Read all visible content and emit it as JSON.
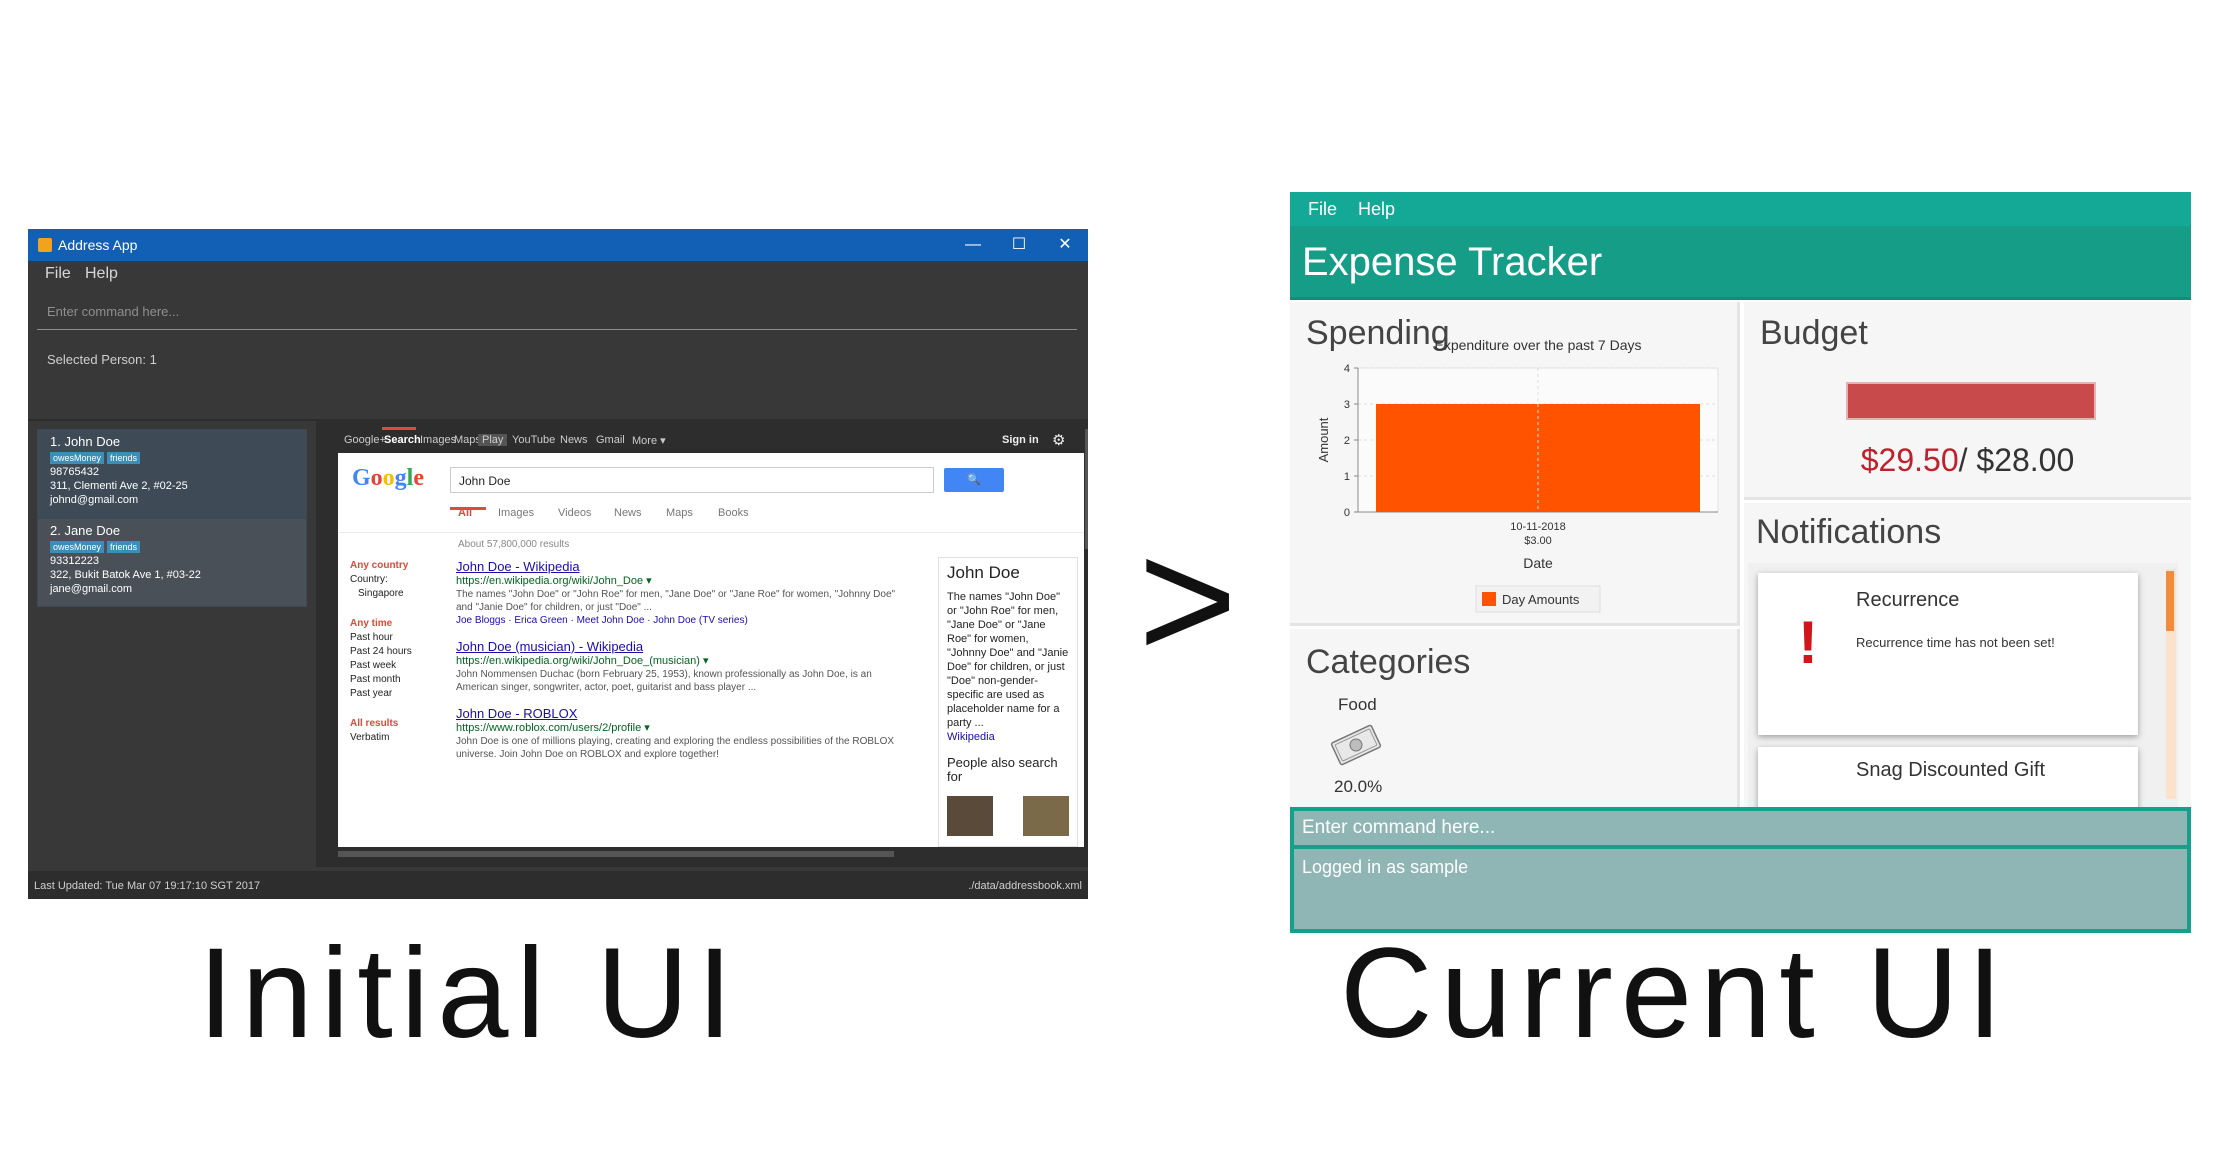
{
  "captions": {
    "initial": "Initial UI",
    "current": "Current UI",
    "arrow": ">"
  },
  "address_app": {
    "title": "Address App",
    "window_controls": {
      "minimize": "—",
      "maximize": "☐",
      "close": "✕"
    },
    "menu": [
      "File",
      "Help"
    ],
    "command_placeholder": "Enter command here...",
    "result": "Selected Person: 1",
    "persons": [
      {
        "name": "1. John Doe",
        "tags": [
          "owesMoney",
          "friends"
        ],
        "phone": "98765432",
        "address": "311, Clementi Ave 2, #02-25",
        "email": "johnd@gmail.com"
      },
      {
        "name": "2. Jane Doe",
        "tags": [
          "owesMoney",
          "friends"
        ],
        "phone": "93312223",
        "address": "322, Bukit Batok Ave 1, #03-22",
        "email": "jane@gmail.com"
      }
    ],
    "status_left": "Last Updated: Tue Mar 07 19:17:10 SGT 2017",
    "status_right": "./data/addressbook.xml",
    "colors": {
      "titlebar": "#1160b5",
      "panel": "#383838",
      "selected_card": "#3f4a57",
      "card": "#4a5058",
      "tag": "#3b8eb8"
    }
  },
  "browser": {
    "topbar": [
      "Google+",
      "Search",
      "Images",
      "Maps",
      "Play",
      "YouTube",
      "News",
      "Gmail",
      "More ▾"
    ],
    "sign_in": "Sign in",
    "logo_letters": [
      {
        "ch": "G",
        "color": "#4285f4"
      },
      {
        "ch": "o",
        "color": "#ea4335"
      },
      {
        "ch": "o",
        "color": "#fbbc05"
      },
      {
        "ch": "g",
        "color": "#4285f4"
      },
      {
        "ch": "l",
        "color": "#34a853"
      },
      {
        "ch": "e",
        "color": "#ea4335"
      }
    ],
    "query": "John Doe",
    "tabs": [
      "All",
      "Images",
      "Videos",
      "News",
      "Maps",
      "Books"
    ],
    "result_count": "About 57,800,000 results",
    "filters": {
      "country_heading": "Any country",
      "country_lines": [
        "Country:",
        "Singapore"
      ],
      "time_heading": "Any time",
      "time_lines": [
        "Past hour",
        "Past 24 hours",
        "Past week",
        "Past month",
        "Past year"
      ],
      "results_heading": "All results",
      "results_lines": [
        "Verbatim"
      ]
    },
    "results": [
      {
        "title": "John Doe - Wikipedia",
        "url": "https://en.wikipedia.org/wiki/John_Doe ▾",
        "snippet": "The names \"John Doe\" or \"John Roe\" for men, \"Jane Doe\" or \"Jane Roe\" for women, \"Johnny Doe\" and \"Janie Doe\" for children, or just \"Doe\" ...",
        "links": "Joe Bloggs · Erica Green · Meet John Doe · John Doe (TV series)"
      },
      {
        "title": "John Doe (musician) - Wikipedia",
        "url": "https://en.wikipedia.org/wiki/John_Doe_(musician) ▾",
        "snippet": "John Nommensen Duchac (born February 25, 1953), known professionally as John Doe, is an American singer, songwriter, actor, poet, guitarist and bass player ...",
        "links": ""
      },
      {
        "title": "John Doe - ROBLOX",
        "url": "https://www.roblox.com/users/2/profile ▾",
        "snippet": "John Doe is one of millions playing, creating and exploring the endless possibilities of the ROBLOX universe. Join John Doe on ROBLOX and explore together!",
        "links": ""
      }
    ],
    "knowledge_panel": {
      "title": "John Doe",
      "text": "The names \"John Doe\" or \"John Roe\" for men, \"Jane Doe\" or \"Jane Roe\" for women, \"Johnny Doe\" and \"Janie Doe\" for children, or just \"Doe\" non-gender-specific are used as placeholder name for a party ...",
      "more": "Wikipedia",
      "people_also": "People also search for"
    }
  },
  "expense_tracker": {
    "menu": [
      "File",
      "Help"
    ],
    "title": "Expense Tracker",
    "spending": {
      "heading": "Spending",
      "bar_color": "#ff5300"
    },
    "categories": {
      "heading": "Categories",
      "label": "Food",
      "percent": "20.0%",
      "icon": "money-icon"
    },
    "budget": {
      "heading": "Budget",
      "spent": "$29.50",
      "limit": "/ $28.00",
      "bar_color": "#c84a4a",
      "fraction_spent": 1.0
    },
    "notifications": {
      "heading": "Notifications",
      "items": [
        {
          "title": "Recurrence",
          "body": "Recurrence time has not been set!",
          "icon": "!"
        },
        {
          "title": "Snag Discounted Gift",
          "body": "",
          "icon": ""
        }
      ]
    },
    "command_placeholder": "Enter command here...",
    "result": "Logged in as sample",
    "colors": {
      "menubar": "#14a896",
      "header": "#159d88",
      "command": "#8fb5b5",
      "accent": "#c0202a"
    }
  },
  "chart_data": {
    "type": "bar",
    "title": "Expenditure over the past 7 Days",
    "categories": [
      "10-11-2018\n$3.00"
    ],
    "series": [
      {
        "name": "Day Amounts",
        "values": [
          3.0
        ]
      }
    ],
    "xlabel": "Date",
    "ylabel": "Amount",
    "ylim": [
      0,
      4
    ],
    "yticks": [
      0,
      1,
      2,
      3,
      4
    ],
    "grid": true,
    "legend": "bottom"
  }
}
